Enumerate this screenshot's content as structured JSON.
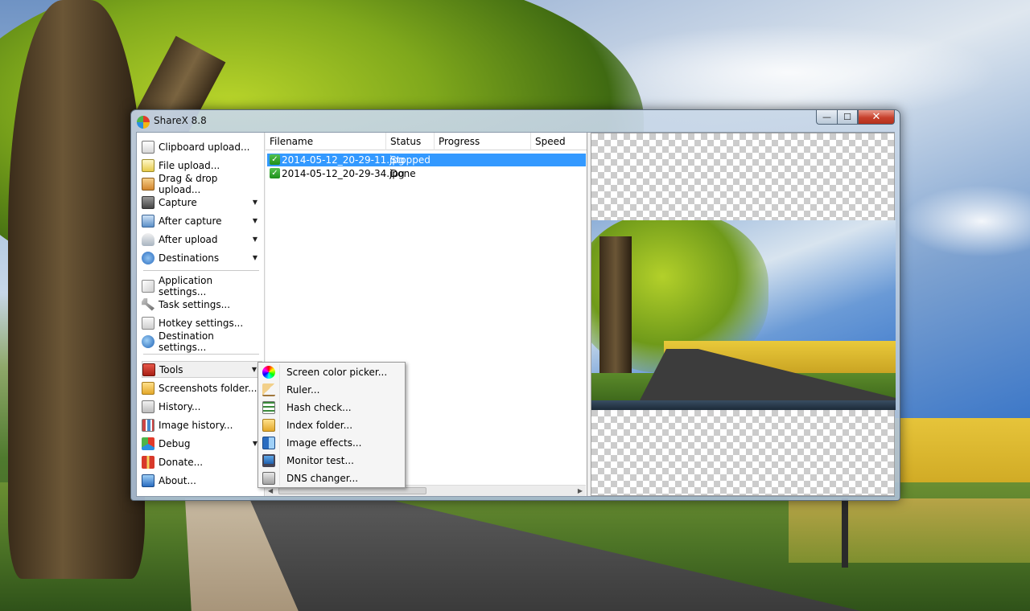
{
  "window": {
    "title": "ShareX 8.8",
    "minimize": "—",
    "maximize": "☐",
    "close": "✕"
  },
  "menu": {
    "items": [
      {
        "label": "Clipboard upload...",
        "icon": "clipboard-icon"
      },
      {
        "label": "File upload...",
        "icon": "file-upload-icon"
      },
      {
        "label": "Drag & drop upload...",
        "icon": "drag-drop-icon"
      },
      {
        "label": "Capture",
        "icon": "camera-icon",
        "submenu": true
      },
      {
        "label": "After capture",
        "icon": "after-capture-icon",
        "submenu": true
      },
      {
        "label": "After upload",
        "icon": "cloud-upload-icon",
        "submenu": true
      },
      {
        "label": "Destinations",
        "icon": "destinations-icon",
        "submenu": true
      },
      {
        "label": "Application settings...",
        "icon": "application-settings-icon"
      },
      {
        "label": "Task settings...",
        "icon": "wrench-icon"
      },
      {
        "label": "Hotkey settings...",
        "icon": "keyboard-icon"
      },
      {
        "label": "Destination settings...",
        "icon": "globe-icon"
      },
      {
        "label": "Tools",
        "icon": "toolbox-icon",
        "submenu": true,
        "active": true
      },
      {
        "label": "Screenshots folder...",
        "icon": "folder-icon"
      },
      {
        "label": "History...",
        "icon": "history-icon"
      },
      {
        "label": "Image history...",
        "icon": "image-history-icon"
      },
      {
        "label": "Debug",
        "icon": "debug-icon",
        "submenu": true
      },
      {
        "label": "Donate...",
        "icon": "gift-icon"
      },
      {
        "label": "About...",
        "icon": "about-icon"
      }
    ],
    "submenu_arrow": "▼"
  },
  "list": {
    "columns": [
      "Filename",
      "Status",
      "Progress",
      "Speed"
    ],
    "rows": [
      {
        "filename": "2014-05-12_20-29-11.jpg",
        "status": "Stopped",
        "selected": true
      },
      {
        "filename": "2014-05-12_20-29-34.jpg",
        "status": "Done",
        "selected": false
      }
    ],
    "check_mark": "✓",
    "scroll_left": "◀",
    "scroll_right": "▶"
  },
  "tools_menu": {
    "items": [
      {
        "label": "Screen color picker...",
        "icon": "color-wheel-icon"
      },
      {
        "label": "Ruler...",
        "icon": "ruler-icon"
      },
      {
        "label": "Hash check...",
        "icon": "hash-check-icon"
      },
      {
        "label": "Index folder...",
        "icon": "index-folder-icon"
      },
      {
        "label": "Image effects...",
        "icon": "image-effects-icon"
      },
      {
        "label": "Monitor test...",
        "icon": "monitor-icon"
      },
      {
        "label": "DNS changer...",
        "icon": "dns-icon"
      }
    ]
  },
  "colors": {
    "selection": "#3399ff",
    "window_frame": "#c8d7e8",
    "close_button": "#c7412c"
  }
}
